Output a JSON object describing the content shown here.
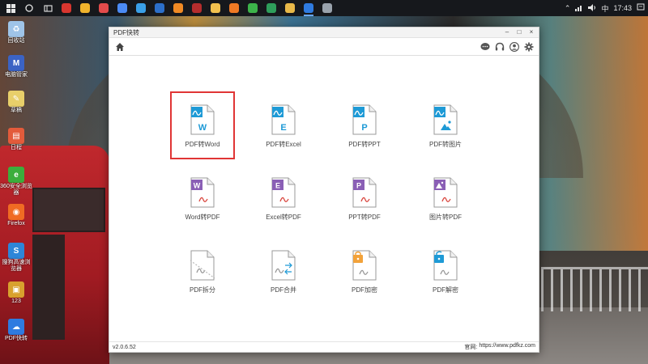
{
  "taskbar": {
    "ime": "中",
    "time": "17:43",
    "apps": [
      {
        "icon": "browser-red-icon",
        "color": "#d8362f"
      },
      {
        "icon": "browser-yellow-icon",
        "color": "#f0b32c"
      },
      {
        "icon": "app-red-icon",
        "color": "#e34b4b"
      },
      {
        "icon": "chrome-icon",
        "color": "#4b8bf4"
      },
      {
        "icon": "app-blue-icon",
        "color": "#3aa0e8"
      },
      {
        "icon": "app-blue-2-icon",
        "color": "#2c6fc9"
      },
      {
        "icon": "app-orange-icon",
        "color": "#f08a24"
      },
      {
        "icon": "app-darkred-icon",
        "color": "#b52d2d"
      },
      {
        "icon": "app-folder-icon",
        "color": "#f2c14e"
      },
      {
        "icon": "app-orange-2-icon",
        "color": "#f07a24"
      },
      {
        "icon": "wechat-icon",
        "color": "#3cb34a"
      },
      {
        "icon": "app-green-icon",
        "color": "#2e9e5b"
      },
      {
        "icon": "file-explorer-icon",
        "color": "#e9b949"
      },
      {
        "icon": "pdf-quick-app-icon",
        "color": "#2f7be0"
      },
      {
        "icon": "app-gray-icon",
        "color": "#9aa3ad"
      }
    ]
  },
  "desktop": {
    "icons": [
      {
        "label": "回收站",
        "color": "#9fc4e8",
        "glyph": "♻"
      },
      {
        "label": "电脑管家",
        "color": "#3b63c4",
        "glyph": "M"
      },
      {
        "label": "草稿",
        "color": "#e8cf6a",
        "glyph": "✎"
      },
      {
        "label": "日程",
        "color": "#e35b3b",
        "glyph": "▤"
      },
      {
        "label": "360安全浏览器",
        "color": "#3cae3c",
        "glyph": "e"
      },
      {
        "label": "Firefox",
        "color": "#f06b23",
        "glyph": "◉"
      },
      {
        "label": "搜狗高速浏览器",
        "color": "#2e86d8",
        "glyph": "S"
      },
      {
        "label": "123",
        "color": "#d8a12e",
        "glyph": "▣"
      },
      {
        "label": "PDF快转",
        "color": "#2f7be0",
        "glyph": "☁"
      }
    ]
  },
  "window": {
    "title": "PDF快转",
    "controls": {
      "minimize": "–",
      "maximize": "□",
      "close": "×"
    },
    "version": "v2.0.6.52",
    "site_label": "官网:",
    "site_url": "https://www.pdfkz.com"
  },
  "colors": {
    "blue": "#1e9ad6",
    "purple": "#8a5fb5",
    "gray": "#a9a9a9",
    "orange": "#f2a23a",
    "pdf_red": "#d9463e",
    "selection": "#e03535"
  },
  "tiles": [
    {
      "label": "PDF转Word",
      "letter": "W",
      "theme": "blue",
      "icon": "pdf-to-word-icon",
      "selected": true
    },
    {
      "label": "PDF转Excel",
      "letter": "E",
      "theme": "blue",
      "icon": "pdf-to-excel-icon"
    },
    {
      "label": "PDF转PPT",
      "letter": "P",
      "theme": "blue",
      "icon": "pdf-to-ppt-icon"
    },
    {
      "label": "PDF转图片",
      "letter": "▲",
      "theme": "blue",
      "icon": "pdf-to-image-icon"
    },
    {
      "label": "Word转PDF",
      "letter": "W",
      "theme": "purple",
      "icon": "word-to-pdf-icon"
    },
    {
      "label": "Excel转PDF",
      "letter": "E",
      "theme": "purple",
      "icon": "excel-to-pdf-icon"
    },
    {
      "label": "PPT转PDF",
      "letter": "P",
      "theme": "purple",
      "icon": "ppt-to-pdf-icon"
    },
    {
      "label": "图片转PDF",
      "letter": "▲",
      "theme": "purple",
      "icon": "image-to-pdf-icon"
    },
    {
      "label": "PDF拆分",
      "letter": "",
      "theme": "gray",
      "icon": "pdf-split-icon"
    },
    {
      "label": "PDF合并",
      "letter": "",
      "theme": "merge",
      "icon": "pdf-merge-icon"
    },
    {
      "label": "PDF加密",
      "letter": "",
      "theme": "lock",
      "icon": "pdf-encrypt-icon"
    },
    {
      "label": "PDF解密",
      "letter": "",
      "theme": "unlock",
      "icon": "pdf-decrypt-icon"
    }
  ]
}
